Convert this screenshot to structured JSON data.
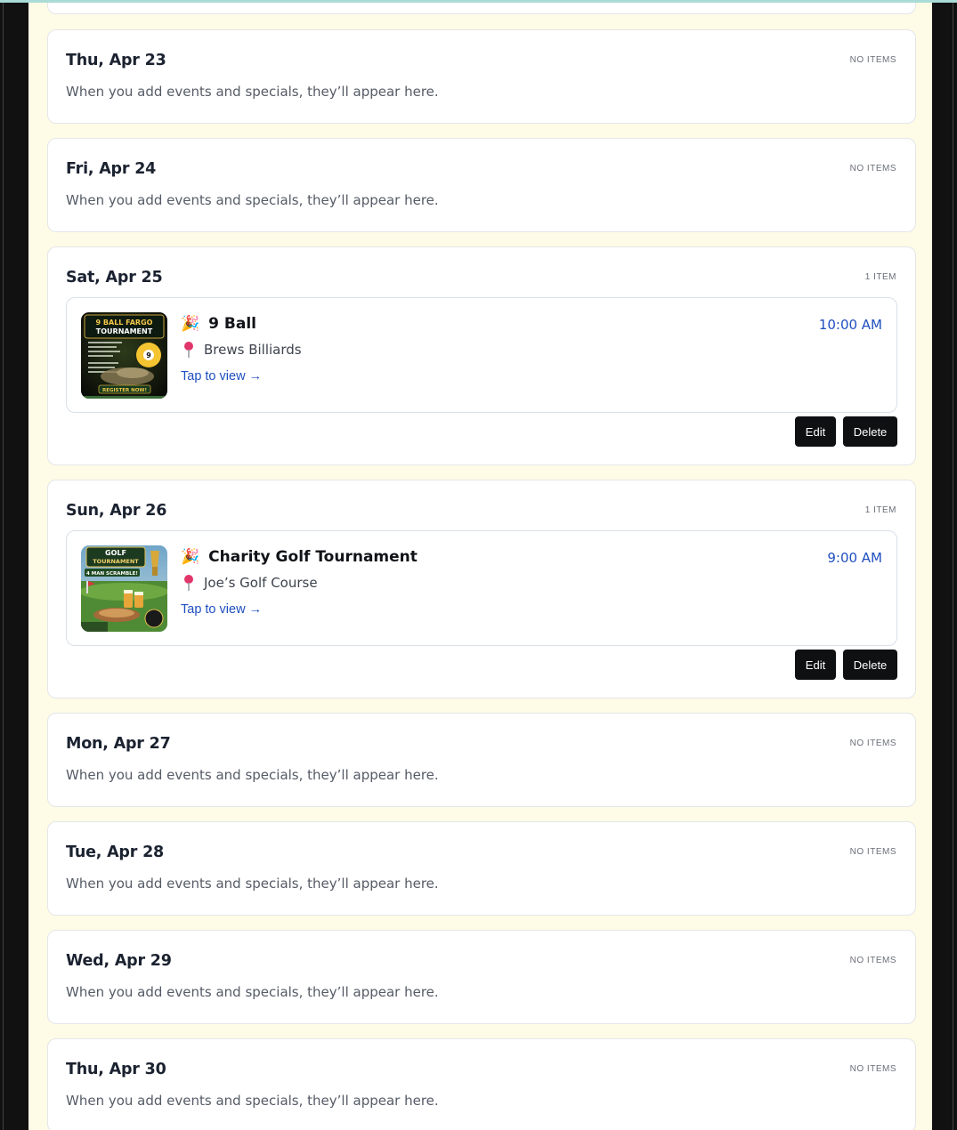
{
  "days": [
    {
      "title": "Thu, Apr 23",
      "count": "NO ITEMS",
      "empty": "When you add events and specials, they’ll appear here."
    },
    {
      "title": "Fri, Apr 24",
      "count": "NO ITEMS",
      "empty": "When you add events and specials, they’ll appear here."
    },
    {
      "title": "Sat, Apr 25",
      "count": "1 ITEM",
      "event": {
        "title": "9 Ball",
        "venue": "Brews Billiards",
        "link": "Tap to view →",
        "time": "10:00 AM",
        "edit": "Edit",
        "delete": "Delete",
        "icon": "party-popper-icon",
        "thumb_text": [
          "9 BALL FARGO",
          "TOURNAMENT",
          "REGISTER NOW!"
        ]
      }
    },
    {
      "title": "Sun, Apr 26",
      "count": "1 ITEM",
      "event": {
        "title": "Charity Golf Tournament",
        "venue": "Joe’s Golf Course",
        "link": "Tap to view →",
        "time": "9:00 AM",
        "edit": "Edit",
        "delete": "Delete",
        "icon": "party-popper-icon",
        "thumb_text": [
          "GOLF",
          "TOURNAMENT",
          "4 MAN SCRAMBLE!"
        ]
      }
    },
    {
      "title": "Mon, Apr 27",
      "count": "NO ITEMS",
      "empty": "When you add events and specials, they’ll appear here."
    },
    {
      "title": "Tue, Apr 28",
      "count": "NO ITEMS",
      "empty": "When you add events and specials, they’ll appear here."
    },
    {
      "title": "Wed, Apr 29",
      "count": "NO ITEMS",
      "empty": "When you add events and specials, they’ll appear here."
    },
    {
      "title": "Thu, Apr 30",
      "count": "NO ITEMS",
      "empty": "When you add events and specials, they’ll appear here."
    }
  ],
  "colors": {
    "panel_bg": "#fefbe6",
    "accent_link": "#1f4fbf",
    "button_bg": "#0f1012",
    "pin": "#e2366b"
  }
}
